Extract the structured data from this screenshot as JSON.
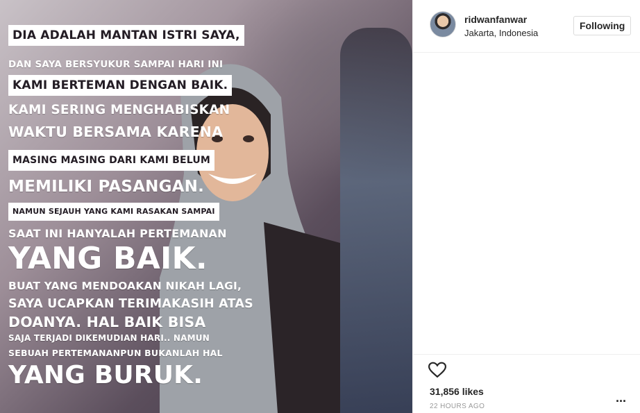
{
  "post": {
    "text_lines": [
      "DIA ADALAH MANTAN ISTRI SAYA,",
      "DAN SAYA BERSYUKUR SAMPAI HARI INI",
      "KAMI BERTEMAN DENGAN BAIK.",
      "KAMI SERING MENGHABISKAN",
      "WAKTU BERSAMA KARENA",
      "MASING MASING DARI KAMI BELUM",
      "MEMILIKI PASANGAN.",
      "NAMUN SEJAUH YANG KAMI RASAKAN SAMPAI",
      "SAAT INI HANYALAH PERTEMANAN",
      "YANG BAIK.",
      "BUAT YANG MENDOAKAN NIKAH LAGI,",
      "SAYA UCAPKAN TERIMAKASIH ATAS",
      "DOANYA. HAL BAIK BISA",
      "SAJA TERJADI DIKEMUDIAN HARI.. NAMUN",
      "SEBUAH PERTEMANANPUN BUKANLAH HAL",
      "YANG BURUK."
    ]
  },
  "header": {
    "username": "ridwanfanwar",
    "location": "Jakarta, Indonesia",
    "follow_label": "Following"
  },
  "footer": {
    "likes": "31,856 likes",
    "time": "22 HOURS AGO",
    "more": "..."
  },
  "icons": {
    "heart": "heart-outline-icon",
    "more": "more-options-icon"
  }
}
